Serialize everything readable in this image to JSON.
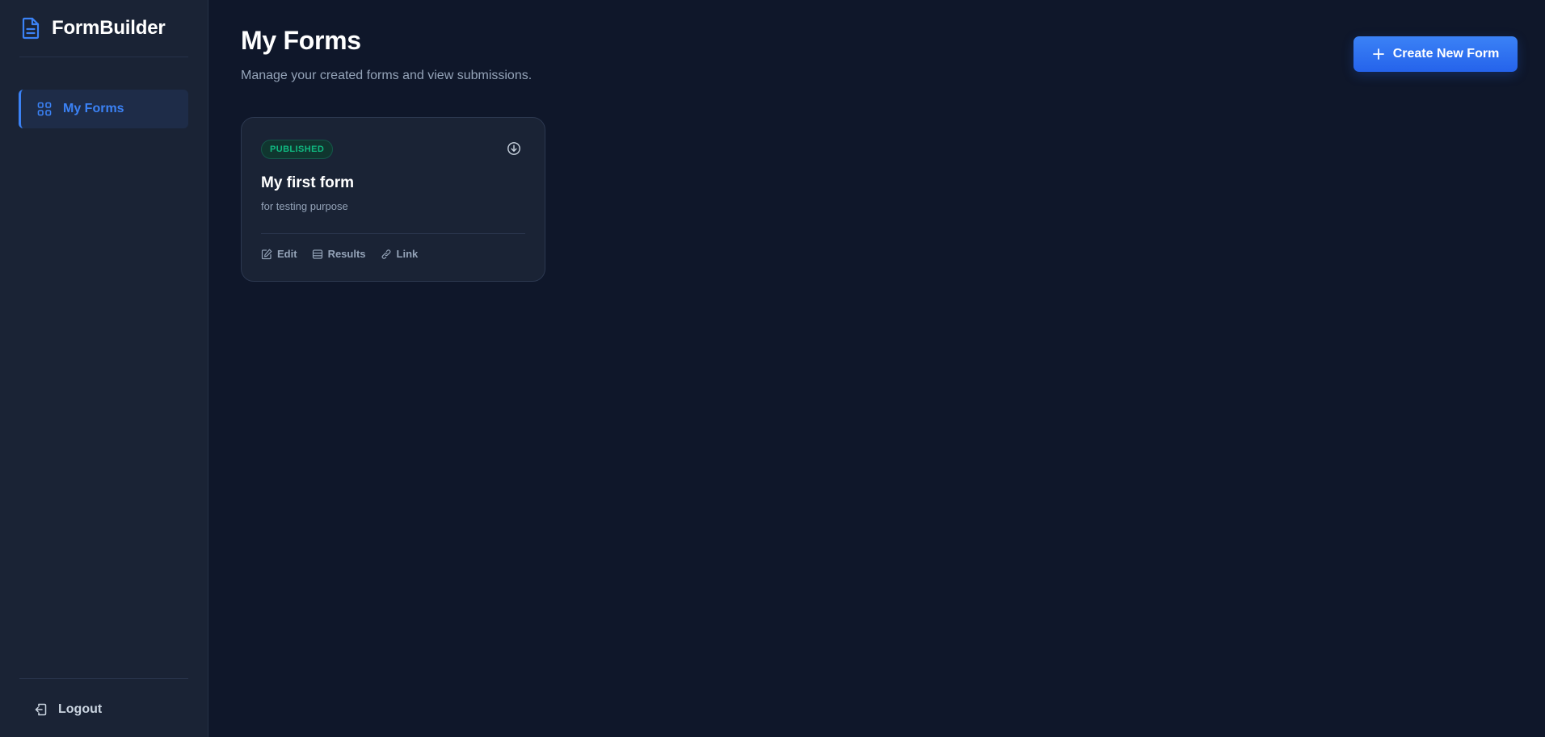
{
  "app": {
    "brand_name": "FormBuilder",
    "brand_icon": "file-text-icon"
  },
  "sidebar": {
    "items": [
      {
        "label": "My Forms",
        "icon": "grid-icon",
        "active": true
      }
    ],
    "logout_label": "Logout",
    "logout_icon": "logout-icon"
  },
  "main": {
    "title": "My Forms",
    "subtitle": "Manage your created forms and view submissions.",
    "create_button_label": "Create New Form",
    "create_button_icon": "plus-icon"
  },
  "forms": [
    {
      "status": "PUBLISHED",
      "title": "My first form",
      "description": "for testing purpose",
      "menu_icon": "download-circle-icon",
      "actions": [
        {
          "label": "Edit",
          "icon": "edit-icon"
        },
        {
          "label": "Results",
          "icon": "table-icon"
        },
        {
          "label": "Link",
          "icon": "link-icon"
        }
      ]
    }
  ],
  "colors": {
    "background": "#0f172a",
    "sidebar": "#1a2335",
    "accent": "#3b82f6",
    "published": "#10b981",
    "card": "#1a2335",
    "muted_text": "#94a3b8"
  }
}
